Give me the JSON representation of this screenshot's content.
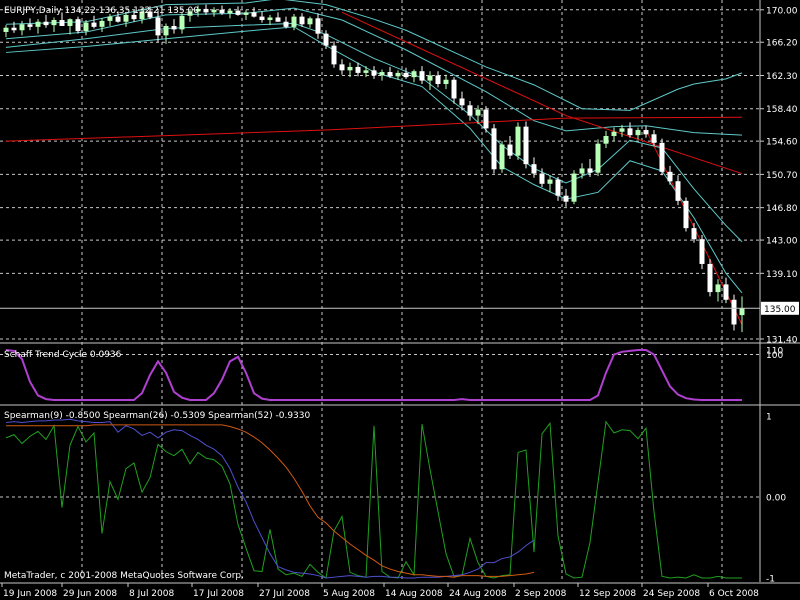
{
  "header": {
    "symbol_info": "EURJPY,Daily  134.22 136.35 132.21 135.00"
  },
  "colors": {
    "background": "#000000",
    "grid": "#c8c8c8",
    "bull_candle": "#b8ffb8",
    "bear_candle": "#ffffff",
    "bands": "#5fc9c9",
    "trendline": "#e01010",
    "stc": "#b040d0",
    "spearman_9": "#20a020",
    "spearman_26": "#5050d0",
    "spearman_52": "#d05a10",
    "price_badge_bg": "#ffffff",
    "price_badge_text": "#000000",
    "separator": "#c8c8c8"
  },
  "panes": {
    "price": {
      "current_price": "135.00",
      "axis_labels": [
        "170.00",
        "166.20",
        "162.30",
        "158.40",
        "154.60",
        "150.70",
        "146.80",
        "143.00",
        "139.10",
        "131.40"
      ]
    },
    "stc": {
      "label": "Schaff Trend Cycle 0.0936",
      "axis_labels": [
        "110",
        "100"
      ]
    },
    "spearman": {
      "label": "Spearman(9) -0.8500  Spearman(26) -0.5309  Spearman(52) -0.9330",
      "axis_labels": [
        "1",
        "0.00",
        "-1"
      ]
    }
  },
  "dates": [
    "19 Jun 2008",
    "29 Jun 2008",
    "8 Jul 2008",
    "17 Jul 2008",
    "27 Jul 2008",
    "5 Aug 2008",
    "14 Aug 2008",
    "24 Aug 2008",
    "2 Sep 2008",
    "12 Sep 2008",
    "24 Sep 2008",
    "6 Oct 2008"
  ],
  "copyright": "MetaTrader, c 2001-2008 MetaQuotes Software Corp.",
  "chart_data": {
    "type": "candlestick",
    "symbol": "EURJPY",
    "timeframe": "Daily",
    "price_range": [
      131.4,
      171.5
    ],
    "ohlc": [
      [
        167.4,
        168.2,
        166.8,
        167.9
      ],
      [
        167.9,
        168.6,
        167.3,
        167.6
      ],
      [
        167.6,
        168.7,
        167.0,
        168.3
      ],
      [
        168.3,
        169.0,
        167.6,
        168.0
      ],
      [
        168.0,
        168.9,
        167.2,
        168.6
      ],
      [
        168.6,
        169.4,
        167.9,
        168.2
      ],
      [
        168.2,
        169.1,
        167.4,
        168.8
      ],
      [
        168.8,
        169.7,
        168.3,
        168.1
      ],
      [
        168.1,
        169.0,
        167.1,
        168.9
      ],
      [
        168.9,
        169.2,
        167.2,
        167.5
      ],
      [
        167.5,
        168.8,
        167.0,
        168.5
      ],
      [
        168.5,
        169.3,
        167.8,
        168.0
      ],
      [
        168.0,
        169.0,
        167.4,
        168.7
      ],
      [
        168.7,
        169.5,
        168.1,
        169.2
      ],
      [
        169.2,
        169.8,
        168.5,
        168.6
      ],
      [
        168.6,
        169.6,
        168.0,
        169.4
      ],
      [
        169.4,
        170.0,
        168.6,
        168.9
      ],
      [
        168.9,
        170.2,
        168.4,
        169.8
      ],
      [
        169.8,
        170.4,
        168.9,
        169.1
      ],
      [
        169.1,
        169.9,
        166.2,
        167.0
      ],
      [
        167.0,
        168.4,
        166.0,
        168.1
      ],
      [
        168.1,
        168.9,
        167.2,
        167.7
      ],
      [
        167.7,
        169.6,
        167.2,
        169.3
      ],
      [
        169.3,
        170.1,
        168.6,
        169.8
      ],
      [
        169.8,
        170.5,
        169.2,
        170.1
      ],
      [
        170.1,
        170.6,
        169.4,
        169.7
      ],
      [
        169.7,
        170.3,
        169.2,
        170.0
      ],
      [
        170.0,
        170.5,
        169.4,
        169.6
      ],
      [
        169.6,
        170.2,
        169.0,
        169.9
      ],
      [
        169.9,
        170.4,
        169.3,
        169.4
      ],
      [
        169.4,
        170.0,
        168.8,
        169.7
      ],
      [
        169.7,
        170.3,
        169.1,
        169.2
      ],
      [
        169.2,
        169.8,
        168.5,
        168.8
      ],
      [
        168.8,
        169.4,
        168.2,
        169.1
      ],
      [
        169.1,
        169.7,
        168.6,
        168.6
      ],
      [
        168.6,
        169.2,
        167.8,
        168.0
      ],
      [
        168.0,
        169.5,
        167.6,
        169.2
      ],
      [
        169.2,
        169.6,
        168.0,
        168.3
      ],
      [
        168.3,
        169.2,
        167.9,
        169.0
      ],
      [
        169.0,
        169.6,
        166.6,
        167.2
      ],
      [
        167.2,
        167.6,
        165.4,
        165.8
      ],
      [
        165.8,
        166.3,
        163.2,
        163.6
      ],
      [
        163.6,
        164.2,
        162.4,
        162.9
      ],
      [
        162.9,
        163.8,
        162.1,
        163.3
      ],
      [
        163.3,
        163.8,
        162.2,
        162.6
      ],
      [
        162.6,
        163.4,
        162.1,
        162.9
      ],
      [
        162.9,
        163.4,
        161.9,
        162.3
      ],
      [
        162.3,
        163.0,
        161.7,
        162.7
      ],
      [
        162.7,
        163.3,
        162.0,
        162.2
      ],
      [
        162.2,
        162.9,
        161.8,
        162.6
      ],
      [
        162.6,
        163.2,
        161.9,
        162.1
      ],
      [
        162.1,
        163.0,
        161.5,
        162.8
      ],
      [
        162.8,
        163.4,
        161.3,
        161.7
      ],
      [
        161.7,
        162.8,
        160.6,
        162.3
      ],
      [
        162.3,
        162.8,
        160.9,
        161.3
      ],
      [
        161.3,
        162.4,
        160.7,
        161.8
      ],
      [
        161.8,
        162.1,
        159.0,
        159.6
      ],
      [
        159.6,
        160.4,
        158.2,
        158.8
      ],
      [
        158.8,
        159.3,
        157.0,
        157.6
      ],
      [
        157.6,
        158.8,
        156.6,
        158.3
      ],
      [
        158.3,
        158.7,
        155.6,
        156.1
      ],
      [
        156.1,
        156.6,
        150.8,
        151.3
      ],
      [
        151.3,
        154.6,
        150.9,
        154.2
      ],
      [
        154.2,
        155.2,
        152.5,
        152.9
      ],
      [
        152.9,
        156.8,
        152.4,
        156.3
      ],
      [
        156.3,
        156.9,
        151.4,
        151.9
      ],
      [
        151.9,
        152.7,
        150.3,
        150.8
      ],
      [
        150.8,
        151.4,
        149.2,
        149.6
      ],
      [
        149.6,
        150.6,
        148.6,
        150.1
      ],
      [
        150.1,
        150.4,
        147.6,
        148.2
      ],
      [
        148.2,
        149.0,
        146.9,
        147.5
      ],
      [
        147.5,
        151.2,
        147.2,
        150.8
      ],
      [
        150.8,
        152.0,
        150.2,
        151.4
      ],
      [
        151.4,
        152.5,
        150.4,
        150.9
      ],
      [
        150.9,
        154.8,
        150.5,
        154.3
      ],
      [
        154.3,
        155.8,
        153.8,
        155.2
      ],
      [
        155.2,
        156.2,
        154.6,
        155.7
      ],
      [
        155.7,
        156.5,
        155.1,
        156.1
      ],
      [
        156.1,
        156.8,
        155.0,
        155.3
      ],
      [
        155.3,
        156.2,
        154.8,
        155.9
      ],
      [
        155.9,
        156.4,
        155.0,
        155.4
      ],
      [
        155.4,
        155.9,
        154.0,
        154.4
      ],
      [
        154.4,
        154.9,
        150.6,
        151.0
      ],
      [
        151.0,
        151.7,
        149.5,
        149.9
      ],
      [
        149.9,
        150.6,
        147.1,
        147.6
      ],
      [
        147.6,
        148.0,
        144.0,
        144.4
      ],
      [
        144.4,
        145.0,
        142.7,
        143.1
      ],
      [
        143.1,
        143.6,
        139.6,
        140.2
      ],
      [
        140.2,
        140.8,
        136.4,
        136.9
      ],
      [
        136.9,
        138.4,
        135.8,
        137.8
      ],
      [
        137.8,
        138.6,
        135.6,
        136.0
      ],
      [
        136.0,
        136.6,
        132.4,
        133.1
      ],
      [
        134.2,
        136.4,
        132.2,
        135.0
      ]
    ],
    "overlays": [
      {
        "name": "upper band",
        "color": "#5fc9c9",
        "points": [
          [
            0,
            168.3
          ],
          [
            10,
            168.6
          ],
          [
            20,
            170.6
          ],
          [
            30,
            170.8
          ],
          [
            34,
            171.3
          ],
          [
            40,
            170.6
          ],
          [
            46,
            168.9
          ],
          [
            50,
            167.6
          ],
          [
            60,
            163.3
          ],
          [
            66,
            161.2
          ],
          [
            72,
            158.4
          ],
          [
            78,
            158.2
          ],
          [
            84,
            160.7
          ],
          [
            86,
            161.3
          ],
          [
            90,
            161.9
          ],
          [
            92,
            162.6
          ]
        ]
      },
      {
        "name": "upper band 2",
        "color": "#5fc9c9",
        "points": [
          [
            0,
            166.6
          ],
          [
            10,
            167.4
          ],
          [
            20,
            169.4
          ],
          [
            30,
            169.6
          ],
          [
            36,
            170.2
          ],
          [
            42,
            168.8
          ],
          [
            50,
            165.3
          ],
          [
            60,
            160.4
          ],
          [
            66,
            157.0
          ],
          [
            70,
            155.8
          ],
          [
            76,
            156.3
          ],
          [
            80,
            156.4
          ],
          [
            86,
            155.6
          ],
          [
            92,
            155.3
          ]
        ]
      },
      {
        "name": "lower band 2",
        "color": "#5fc9c9",
        "points": [
          [
            0,
            165.6
          ],
          [
            10,
            166.6
          ],
          [
            20,
            167.8
          ],
          [
            30,
            168.2
          ],
          [
            36,
            168.4
          ],
          [
            40,
            167.1
          ],
          [
            46,
            164.3
          ],
          [
            52,
            162.0
          ],
          [
            58,
            157.7
          ],
          [
            62,
            154.1
          ],
          [
            66,
            151.4
          ],
          [
            70,
            149.7
          ],
          [
            74,
            151.3
          ],
          [
            78,
            154.7
          ],
          [
            82,
            153.8
          ],
          [
            86,
            149.0
          ],
          [
            90,
            144.7
          ],
          [
            92,
            142.8
          ]
        ]
      },
      {
        "name": "lower band",
        "color": "#5fc9c9",
        "points": [
          [
            0,
            165.0
          ],
          [
            10,
            165.7
          ],
          [
            20,
            166.6
          ],
          [
            30,
            167.5
          ],
          [
            36,
            168.0
          ],
          [
            40,
            165.8
          ],
          [
            46,
            162.7
          ],
          [
            52,
            161.0
          ],
          [
            58,
            156.1
          ],
          [
            62,
            151.6
          ],
          [
            66,
            149.5
          ],
          [
            70,
            147.8
          ],
          [
            74,
            148.6
          ],
          [
            78,
            152.3
          ],
          [
            82,
            151.1
          ],
          [
            86,
            145.6
          ],
          [
            90,
            139.1
          ],
          [
            92,
            136.8
          ]
        ]
      },
      {
        "name": "long trendline",
        "color": "#e01010",
        "points": [
          [
            0,
            154.6
          ],
          [
            40,
            155.9
          ],
          [
            70,
            157.3
          ],
          [
            92,
            157.4
          ]
        ]
      },
      {
        "name": "trend line",
        "color": "#e01010",
        "points": [
          [
            42,
            169.7
          ],
          [
            70,
            157.6
          ],
          [
            92,
            150.8
          ]
        ]
      },
      {
        "name": "trend line 2",
        "color": "#e01010",
        "points": [
          [
            80,
            155.9
          ],
          [
            92,
            133.1
          ]
        ]
      }
    ],
    "stc": {
      "name": "Schaff Trend Cycle",
      "range": [
        0,
        110
      ],
      "values": [
        110,
        108,
        90,
        40,
        10,
        2,
        0,
        0,
        0,
        0,
        0,
        0,
        0,
        0,
        0,
        0,
        0,
        15,
        55,
        85,
        60,
        18,
        5,
        0,
        0,
        0,
        15,
        45,
        85,
        95,
        60,
        15,
        3,
        0,
        0,
        0,
        0,
        0,
        0,
        0,
        0,
        0,
        0,
        0,
        0,
        0,
        0,
        0,
        0,
        0,
        0,
        0,
        0,
        0,
        0,
        0,
        0,
        2,
        0,
        0,
        0,
        0,
        0,
        0,
        0,
        0,
        0,
        0,
        0,
        0,
        0,
        0,
        0,
        0,
        10,
        60,
        100,
        106,
        108,
        110,
        110,
        100,
        65,
        30,
        12,
        4,
        1,
        0,
        0,
        0,
        0,
        0,
        0
      ]
    },
    "spearman": [
      {
        "name": "Spearman(9)",
        "color": "#20a020",
        "values": [
          0.73,
          0.77,
          0.66,
          0.75,
          0.81,
          0.71,
          0.88,
          -0.13,
          0.64,
          0.87,
          0.68,
          0.79,
          -0.45,
          0.19,
          -0.03,
          0.35,
          0.42,
          0.06,
          0.24,
          0.65,
          0.56,
          0.51,
          0.59,
          0.41,
          0.55,
          0.48,
          0.46,
          0.38,
          0.16,
          -0.34,
          -0.63,
          -0.91,
          -0.92,
          -0.4,
          -0.89,
          -0.96,
          -0.94,
          -0.98,
          -0.83,
          -0.93,
          -1.0,
          -0.42,
          -0.24,
          -0.93,
          -0.97,
          -0.99,
          0.88,
          -0.92,
          -0.99,
          -1.0,
          -0.8,
          -0.96,
          0.9,
          0.34,
          -0.18,
          -0.7,
          -0.98,
          -0.97,
          -0.51,
          -0.81,
          -0.98,
          -1.0,
          -0.97,
          -0.96,
          0.55,
          0.58,
          -0.68,
          0.78,
          0.91,
          -0.48,
          -0.95,
          -1.0,
          -0.99,
          -0.56,
          0.18,
          0.93,
          0.79,
          0.83,
          0.82,
          0.72,
          0.85,
          -0.18,
          -0.98,
          -1.0,
          -0.99,
          -1.0,
          -0.96,
          -1.0,
          -1.0,
          -0.98,
          -1.0,
          -1.0,
          -1.0
        ]
      },
      {
        "name": "Spearman(26)",
        "color": "#5050d0",
        "values": [
          0.92,
          0.93,
          0.92,
          0.93,
          0.94,
          0.94,
          0.95,
          0.95,
          0.96,
          0.94,
          0.93,
          0.92,
          0.92,
          0.93,
          0.8,
          0.88,
          0.84,
          0.76,
          0.8,
          0.73,
          0.8,
          0.83,
          0.82,
          0.76,
          0.71,
          0.64,
          0.59,
          0.51,
          0.35,
          0.12,
          -0.06,
          -0.3,
          -0.5,
          -0.7,
          -0.86,
          -0.9,
          -0.93,
          -0.94,
          -0.95,
          -0.97,
          -1.0,
          -0.99,
          -0.98,
          -0.97,
          -0.98,
          -0.99,
          -0.98,
          -0.98,
          -0.99,
          -0.99,
          -1.0,
          -1.0,
          -0.99,
          -0.99,
          -0.99,
          -0.98,
          -0.97,
          -0.96,
          -0.93,
          -0.89,
          -0.81,
          -0.81,
          -0.76,
          -0.74,
          -0.68,
          -0.6,
          -0.53
        ]
      },
      {
        "name": "Spearman(52)",
        "color": "#d05a10",
        "values": [
          0.88,
          0.88,
          0.88,
          0.88,
          0.88,
          0.88,
          0.88,
          0.88,
          0.88,
          0.88,
          0.88,
          0.89,
          0.89,
          0.89,
          0.89,
          0.89,
          0.89,
          0.89,
          0.89,
          0.89,
          0.89,
          0.89,
          0.89,
          0.89,
          0.89,
          0.89,
          0.89,
          0.89,
          0.87,
          0.84,
          0.8,
          0.74,
          0.67,
          0.58,
          0.48,
          0.37,
          0.23,
          0.07,
          -0.11,
          -0.25,
          -0.32,
          -0.42,
          -0.5,
          -0.58,
          -0.65,
          -0.72,
          -0.78,
          -0.85,
          -0.89,
          -0.92,
          -0.94,
          -0.96,
          -0.96,
          -0.97,
          -0.98,
          -0.98,
          -0.99,
          -0.97,
          -0.97,
          -0.97,
          -0.98,
          -0.98,
          -0.98,
          -0.97,
          -0.96,
          -0.95,
          -0.93
        ]
      }
    ]
  }
}
